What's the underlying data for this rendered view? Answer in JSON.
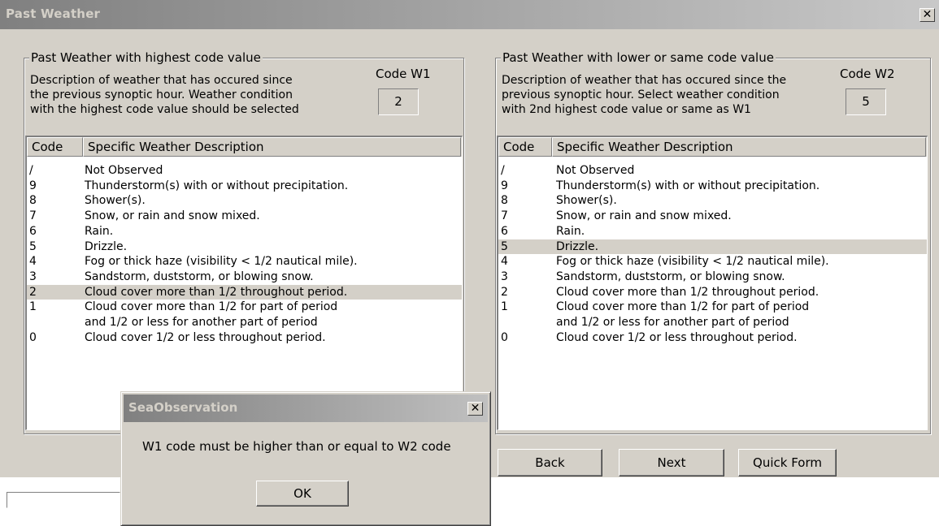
{
  "window": {
    "title": "Past Weather",
    "close_glyph": "✕"
  },
  "left_panel": {
    "group_label": "Past Weather with highest code value",
    "description": "Description of weather that has occured since\nthe previous synoptic hour.  Weather condition\nwith the highest code value should be selected",
    "code_label": "Code W1",
    "code_value": "2",
    "columns": [
      "Code",
      "Specific Weather Description"
    ],
    "selected_code": "2",
    "rows": [
      {
        "code": "/",
        "desc": "Not Observed"
      },
      {
        "code": "9",
        "desc": "Thunderstorm(s) with or without precipitation."
      },
      {
        "code": "8",
        "desc": "Shower(s)."
      },
      {
        "code": "7",
        "desc": "Snow, or rain and snow mixed."
      },
      {
        "code": "6",
        "desc": "Rain."
      },
      {
        "code": "5",
        "desc": "Drizzle."
      },
      {
        "code": "4",
        "desc": "Fog or thick haze (visibility < 1/2 nautical mile)."
      },
      {
        "code": "3",
        "desc": "Sandstorm, duststorm, or blowing snow."
      },
      {
        "code": "2",
        "desc": "Cloud cover more than 1/2 throughout period."
      },
      {
        "code": "1",
        "desc": "Cloud cover more than 1/2 for part of period\nand 1/2 or less for another part of period"
      },
      {
        "code": "0",
        "desc": "Cloud cover 1/2 or less throughout period."
      }
    ]
  },
  "right_panel": {
    "group_label": "Past Weather with lower or same code value",
    "description": "Description of weather that has occured since the\nprevious synoptic hour.  Select weather condition\nwith 2nd highest code value or same as W1",
    "code_label": "Code  W2",
    "code_value": "5",
    "columns": [
      "Code",
      "Specific Weather Description"
    ],
    "selected_code": "5",
    "rows": [
      {
        "code": "/",
        "desc": "Not Observed"
      },
      {
        "code": "9",
        "desc": "Thunderstorm(s) with or without precipitation."
      },
      {
        "code": "8",
        "desc": "Shower(s)."
      },
      {
        "code": "7",
        "desc": "Snow, or rain and snow mixed."
      },
      {
        "code": "6",
        "desc": "Rain."
      },
      {
        "code": "5",
        "desc": "Drizzle."
      },
      {
        "code": "4",
        "desc": "Fog or thick haze (visibility < 1/2 nautical mile)."
      },
      {
        "code": "3",
        "desc": "Sandstorm, duststorm, or blowing snow."
      },
      {
        "code": "2",
        "desc": "Cloud cover more than 1/2 throughout period."
      },
      {
        "code": "1",
        "desc": "Cloud cover more than 1/2 for part of period\nand 1/2 or less for another part of period"
      },
      {
        "code": "0",
        "desc": "Cloud cover 1/2 or less throughout period."
      }
    ]
  },
  "buttons": {
    "back": "Back",
    "next": "Next",
    "quick_form": "Quick Form"
  },
  "dialog": {
    "title": "SeaObservation",
    "close_glyph": "✕",
    "message": "W1 code must be higher than or equal to W2 code",
    "ok": "OK"
  },
  "colors": {
    "face": "#d4d0c8",
    "title_gradient_start": "#808080",
    "title_gradient_end": "#c8c8c8",
    "selection": "#d4d0c8"
  }
}
